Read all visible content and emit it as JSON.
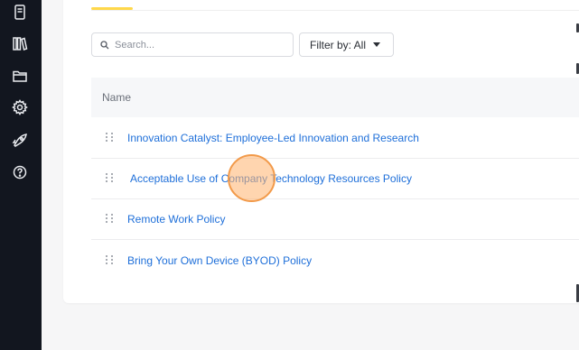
{
  "sidebar": {
    "icons": [
      {
        "name": "document-icon"
      },
      {
        "name": "library-icon"
      },
      {
        "name": "folder-icon"
      },
      {
        "name": "gear-icon"
      },
      {
        "name": "rocket-icon"
      },
      {
        "name": "help-icon"
      }
    ]
  },
  "toolbar": {
    "search_placeholder": "Search...",
    "filter_label": "Filter by: All"
  },
  "table": {
    "column_name": "Name",
    "rows": [
      {
        "title": "Innovation Catalyst: Employee-Led Innovation and Research"
      },
      {
        "title": "Acceptable Use of Company Technology Resources Policy"
      },
      {
        "title": "Remote Work Policy"
      },
      {
        "title": "Bring Your Own Device (BYOD) Policy"
      }
    ]
  },
  "colors": {
    "accent_tab": "#ffd84a",
    "link": "#1e6fd9",
    "sidebar_bg": "#12161f"
  }
}
